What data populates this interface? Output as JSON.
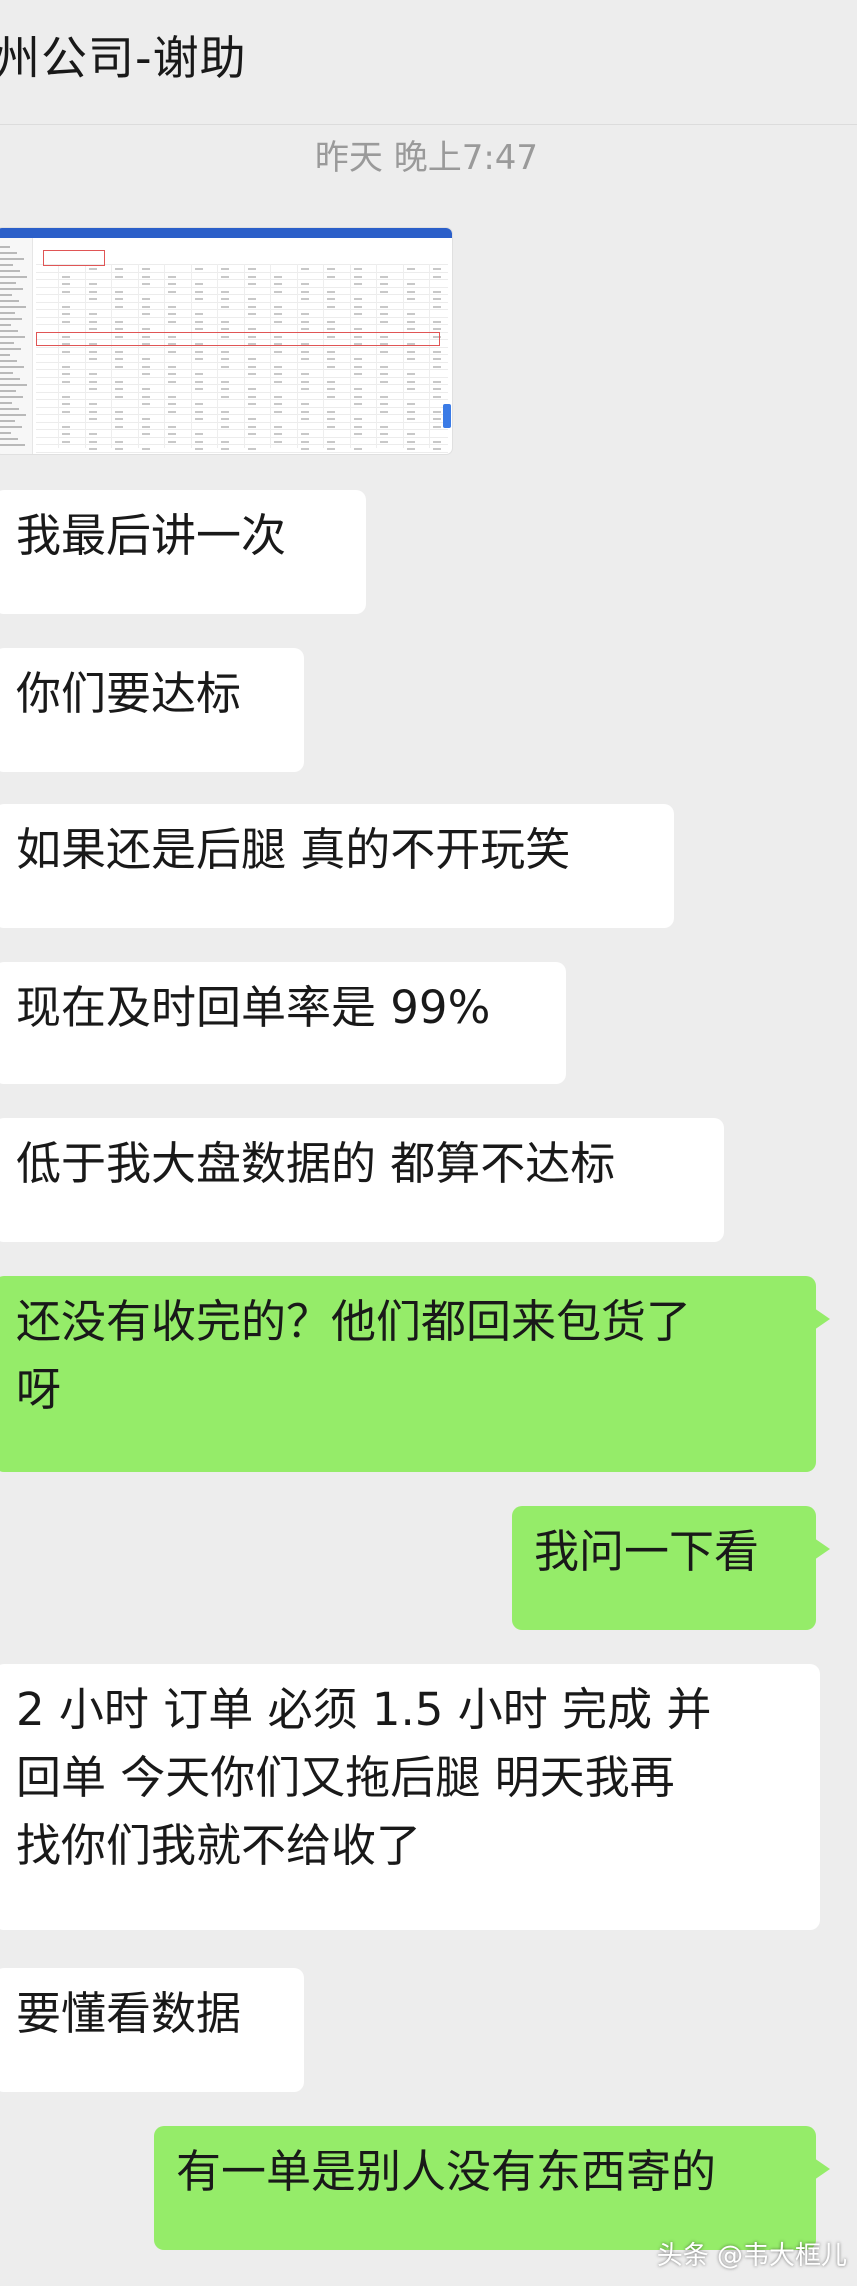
{
  "header": {
    "title": "州公司-谢助"
  },
  "timestamp": "昨天 晚上7:47",
  "messages": {
    "m1": "我最后讲一次",
    "m2": "你们要达标",
    "m3": "如果还是后腿 真的不开玩笑",
    "m4": "现在及时回单率是 99%",
    "m5": "低于我大盘数据的 都算不达标",
    "m6_line1": "还没有收完的？他们都回来包货了",
    "m6_line2": "呀",
    "m7": "我问一下看",
    "m8_line1": "2 小时  订单   必须  1.5 小时  完成  并",
    "m8_line2": "回单   今天你们又拖后腿   明天我再",
    "m8_line3": "找你们我就不给收了",
    "m9": "要懂看数据",
    "m10": "有一单是别人没有东西寄的"
  },
  "watermark": "头条 @韦大框儿",
  "colors": {
    "background": "#ededed",
    "incoming_bubble": "#ffffff",
    "outgoing_bubble": "#95ec69"
  }
}
